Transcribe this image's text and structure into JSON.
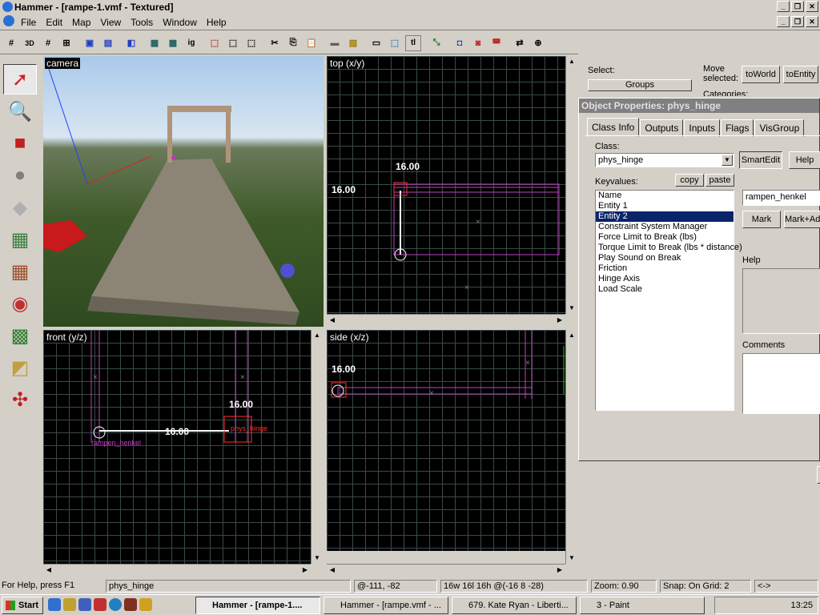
{
  "window": {
    "title": "Hammer - [rampe-1.vmf - Textured]"
  },
  "menu": [
    "File",
    "Edit",
    "Map",
    "View",
    "Tools",
    "Window",
    "Help"
  ],
  "toolbar": {
    "icons": [
      "grid-icon",
      "3d-grid-icon",
      "grid-toggle-icon",
      "snap-icon",
      "group-icon",
      "ungroup-icon",
      "carve-icon",
      "hide-icon",
      "unhide-icon",
      "vis-icon",
      "cut-icon",
      "copy-icon",
      "paste-icon",
      "texture-lock-icon",
      "texture-app-icon",
      "bounding-box-icon",
      "select-icon",
      "tl-icon",
      "flip-icon",
      "light-icon",
      "entity-report-icon",
      "check-problems-icon",
      "run-map-icon"
    ]
  },
  "tools": [
    "selection-tool-icon",
    "magnify-tool-icon",
    "camera-tool-icon",
    "entity-tool-icon",
    "block-tool-icon",
    "texture-tool-icon",
    "apply-texture-icon",
    "decal-tool-icon",
    "overlay-tool-icon",
    "clipping-tool-icon",
    "vertex-tool-icon"
  ],
  "viewports": {
    "camera": {
      "label": "camera"
    },
    "top": {
      "label": "top (x/y)",
      "dim_x": "16.00",
      "dim_y": "16.00"
    },
    "front": {
      "label": "front (y/z)",
      "dim_x": "16.00",
      "dim_y": "16.00",
      "entity1": "phys_hinge",
      "entity2": "rampen_henkel"
    },
    "side": {
      "label": "side (x/z)",
      "dim_x": "16.00"
    }
  },
  "select": {
    "label": "Select:",
    "groups": "Groups"
  },
  "move": {
    "label": "Move selected:",
    "to_world": "toWorld",
    "to_entity": "toEntity",
    "categories": "Categories:"
  },
  "props": {
    "title": "Object Properties: phys_hinge",
    "tabs": [
      "Class Info",
      "Outputs",
      "Inputs",
      "Flags",
      "VisGroup"
    ],
    "class_label": "Class:",
    "class_value": "phys_hinge",
    "smartedit": "SmartEdit",
    "help_btn": "Help",
    "keyvalues_label": "Keyvalues:",
    "copy": "copy",
    "paste": "paste",
    "keys": [
      "Name",
      "Entity 1",
      "Entity 2",
      "Constraint System Manager",
      "Force Limit to Break (lbs)",
      "Torque Limit to Break (lbs * distance)",
      "Play Sound on Break",
      "Friction",
      "Hinge Axis",
      "Load Scale"
    ],
    "selected_index": 2,
    "value": "rampen_henkel",
    "mark": "Mark",
    "mark_add": "Mark+Add",
    "help_label": "Help",
    "comments_label": "Comments"
  },
  "status": {
    "help": "For Help, press F1",
    "selection": "phys_hinge",
    "coords": "@-111, -82",
    "size": "16w 16l 16h @(-16 8 -28)",
    "zoom": "Zoom: 0.90",
    "snap": "Snap: On Grid: 2",
    "extra": "<->"
  },
  "taskbar": {
    "start": "Start",
    "tasks": [
      "Hammer - [rampe-1....",
      "Hammer - [rampe.vmf - ...",
      "679. Kate Ryan - Liberti...",
      "3 - Paint"
    ],
    "clock": "13:25"
  }
}
